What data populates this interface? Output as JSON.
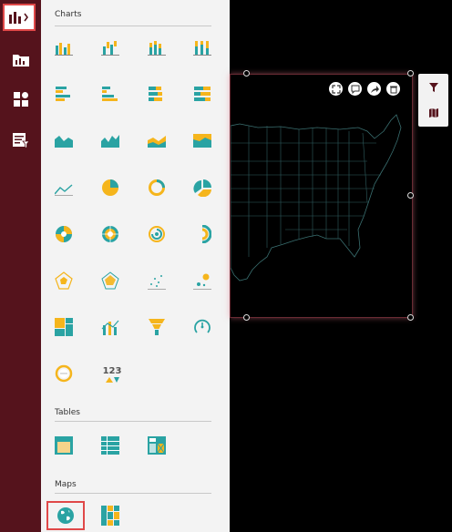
{
  "colors": {
    "accent": "#55131c",
    "teal": "#2aa3a3",
    "yellow": "#f5b51c",
    "highlight": "#e04848"
  },
  "rail": {
    "items": [
      {
        "name": "charts",
        "icon": "bar-chart-icon",
        "selected": true
      },
      {
        "name": "data-source",
        "icon": "folder-chart-icon"
      },
      {
        "name": "dashboard",
        "icon": "grid-icon"
      },
      {
        "name": "filter-list",
        "icon": "filter-document-icon"
      }
    ]
  },
  "panel": {
    "charts_title": "Charts",
    "tables_title": "Tables",
    "maps_title": "Maps",
    "value_tile_text": "123"
  },
  "widget": {
    "tools": [
      "expand-icon",
      "comment-icon",
      "share-icon",
      "delete-icon"
    ],
    "side": [
      "filter-icon",
      "map-icon"
    ]
  }
}
